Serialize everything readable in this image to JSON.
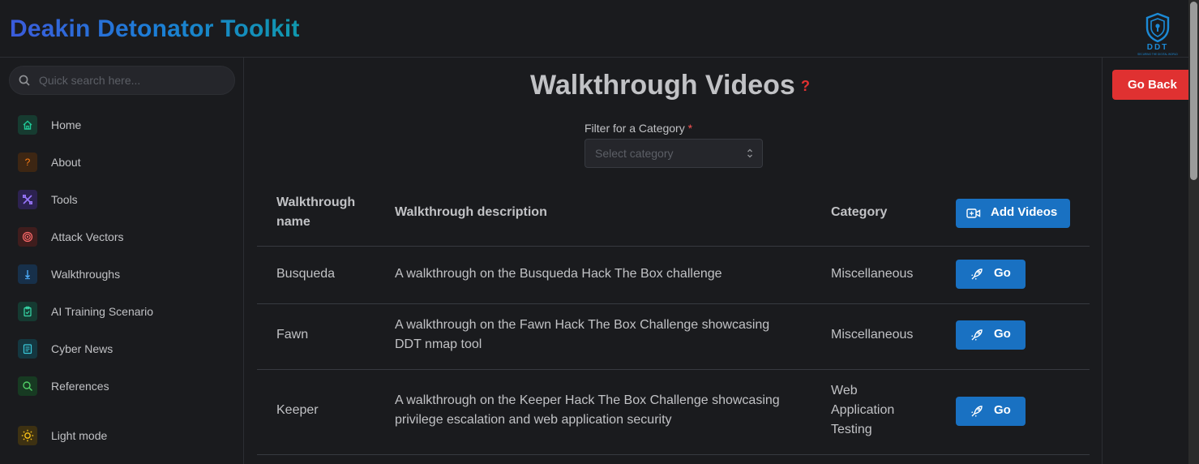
{
  "app": {
    "title": "Deakin Detonator Toolkit",
    "logo_text": "DDT",
    "logo_tagline": "SECURING THE DIGITAL WORLD"
  },
  "search": {
    "placeholder": "Quick search here..."
  },
  "sidebar": {
    "items": [
      {
        "label": "Home",
        "icon": "home-icon",
        "color": "#20c997"
      },
      {
        "label": "About",
        "icon": "question-icon",
        "color": "#fd7e14"
      },
      {
        "label": "Tools",
        "icon": "tools-icon",
        "color": "#9775fa"
      },
      {
        "label": "Attack Vectors",
        "icon": "target-icon",
        "color": "#ff6b6b"
      },
      {
        "label": "Walkthroughs",
        "icon": "arrow-down-icon",
        "color": "#4dabf7"
      },
      {
        "label": "AI Training Scenario",
        "icon": "clipboard-icon",
        "color": "#38d9a9"
      },
      {
        "label": "Cyber News",
        "icon": "news-icon",
        "color": "#3bc9db"
      },
      {
        "label": "References",
        "icon": "search-icon",
        "color": "#51cf66"
      }
    ],
    "theme_toggle": {
      "label": "Light mode",
      "icon": "sun-icon",
      "color": "#fcc419"
    }
  },
  "page": {
    "title": "Walkthrough Videos",
    "help": "?",
    "go_back": "Go Back",
    "filter": {
      "label": "Filter for a Category",
      "required_mark": "*",
      "placeholder": "Select category"
    }
  },
  "table": {
    "headers": {
      "name_line1": "Walkthrough",
      "name_line2": "name",
      "description": "Walkthrough description",
      "category": "Category",
      "add_button": "Add Videos"
    },
    "rows": [
      {
        "name": "Busqueda",
        "desc_lines": [
          "A walkthrough on the Busqueda Hack The Box challenge"
        ],
        "category_lines": [
          "Miscellaneous"
        ],
        "action": "Go"
      },
      {
        "name": "Fawn",
        "desc_lines": [
          "A walkthrough on the Fawn Hack The Box Challenge showcasing",
          "DDT nmap tool"
        ],
        "category_lines": [
          "Miscellaneous"
        ],
        "action": "Go"
      },
      {
        "name": "Keeper",
        "desc_lines": [
          "A walkthrough on the Keeper Hack The Box Challenge showcasing",
          "privilege escalation and web application security"
        ],
        "category_lines": [
          "Web",
          "Application",
          "Testing"
        ],
        "action": "Go"
      }
    ]
  },
  "colors": {
    "background": "#1a1b1e",
    "primary_button": "#1971c2",
    "danger_button": "#e03131"
  }
}
